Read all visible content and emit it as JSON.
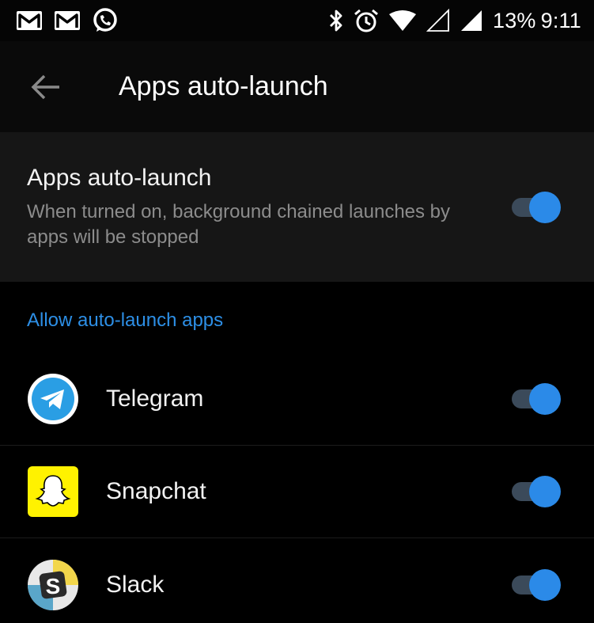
{
  "status_bar": {
    "left_icons": [
      "gmail-icon",
      "gmail-icon",
      "whatsapp-icon"
    ],
    "right_icons": [
      "bluetooth-icon",
      "alarm-icon",
      "wifi-icon",
      "signal-empty-icon",
      "signal-icon"
    ],
    "battery": "13%",
    "time": "9:11"
  },
  "toolbar": {
    "title": "Apps auto-launch"
  },
  "main_setting": {
    "title": "Apps auto-launch",
    "description": "When turned on, background chained launches by apps will be stopped",
    "enabled": true
  },
  "section": {
    "header": "Allow auto-launch apps"
  },
  "apps": [
    {
      "name": "Telegram",
      "icon": "telegram-icon",
      "enabled": true
    },
    {
      "name": "Snapchat",
      "icon": "snapchat-icon",
      "enabled": true
    },
    {
      "name": "Slack",
      "icon": "slack-icon",
      "enabled": true
    }
  ],
  "colors": {
    "accent": "#2b8ae8",
    "section_header": "#2d8fe6",
    "background": "#000000",
    "card": "#161616"
  }
}
